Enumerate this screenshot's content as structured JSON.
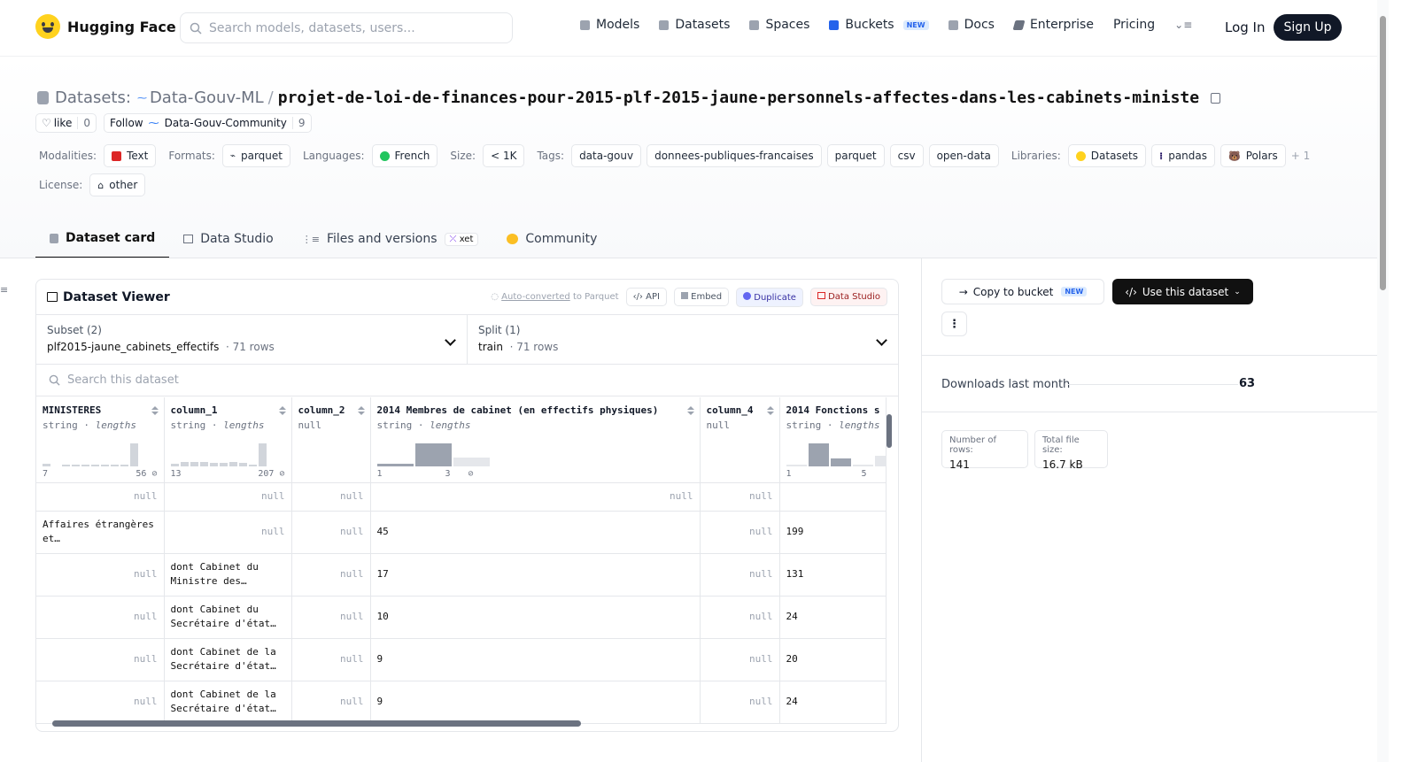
{
  "nav": {
    "brand": "Hugging Face",
    "search_placeholder": "Search models, datasets, users...",
    "links": [
      {
        "label": "Models",
        "color": "#9ca3af"
      },
      {
        "label": "Datasets",
        "color": "#9ca3af"
      },
      {
        "label": "Spaces",
        "color": "#9ca3af"
      },
      {
        "label": "Buckets",
        "color": "#2563eb"
      },
      {
        "label": "Docs",
        "color": "#9ca3af"
      },
      {
        "label": "Enterprise",
        "color": "#6b7280"
      },
      {
        "label": "Pricing"
      }
    ],
    "new_badge": "NEW",
    "login": "Log In",
    "signup": "Sign Up"
  },
  "header": {
    "prefix": "Datasets:",
    "owner": "Data-Gouv-ML",
    "slash": "/",
    "repo": "projet-de-loi-de-finances-pour-2015-plf-2015-jaune-personnels-affectes-dans-les-cabinets-ministe",
    "like_label": "like",
    "like_count": "0",
    "follow_label": "Follow",
    "follow_org": "Data-Gouv-Community",
    "follow_count": "9"
  },
  "tags": {
    "modalities_label": "Modalities:",
    "modality": "Text",
    "formats_label": "Formats:",
    "format": "parquet",
    "languages_label": "Languages:",
    "language": "French",
    "size_label": "Size:",
    "size": "< 1K",
    "tags_label": "Tags:",
    "tag_items": [
      "data-gouv",
      "donnees-publiques-francaises",
      "parquet",
      "csv",
      "open-data"
    ],
    "libraries_label": "Libraries:",
    "libraries": [
      "Datasets",
      "pandas",
      "Polars"
    ],
    "libraries_more": "+ 1",
    "license_label": "License:",
    "license": "other"
  },
  "tabs": {
    "dataset_card": "Dataset card",
    "data_studio": "Data Studio",
    "files": "Files and versions",
    "xet": "xet",
    "community": "Community"
  },
  "viewer": {
    "title": "Dataset Viewer",
    "autoconv_a": "Auto-converted",
    "autoconv_b": "to Parquet",
    "api": "API",
    "embed": "Embed",
    "duplicate": "Duplicate",
    "data_studio": "Data Studio",
    "subset_label": "Subset (2)",
    "subset_value": "plf2015-jaune_cabinets_effectifs",
    "subset_rows": "· 71 rows",
    "split_label": "Split (1)",
    "split_value": "train",
    "split_rows": "· 71 rows",
    "search_placeholder": "Search this dataset",
    "columns": [
      {
        "name": "MINISTERES",
        "type": "string",
        "stat": "lengths",
        "min": "7",
        "max": "56 ⊘"
      },
      {
        "name": "column_1",
        "type": "string",
        "stat": "lengths",
        "min": "13",
        "max": "207 ⊘"
      },
      {
        "name": "column_2",
        "type": "null"
      },
      {
        "name": "2014 Membres de cabinet (en effectifs physiques)",
        "type": "string",
        "stat": "lengths",
        "min": "1",
        "mid": "3",
        "max": "⊘"
      },
      {
        "name": "column_4",
        "type": "null"
      },
      {
        "name": "2014 Fonctions s",
        "type": "string",
        "stat": "lengths",
        "min": "1",
        "max": "5"
      }
    ],
    "rows": [
      [
        "null",
        "null",
        "null",
        "null",
        "null",
        ""
      ],
      [
        "Affaires étrangères et…",
        "null",
        "null",
        "45",
        "null",
        "199"
      ],
      [
        "null",
        "dont Cabinet du Ministre des…",
        "null",
        "17",
        "null",
        "131"
      ],
      [
        "null",
        "dont Cabinet du Secrétaire d'état…",
        "null",
        "10",
        "null",
        "24"
      ],
      [
        "null",
        "dont Cabinet de la Secrétaire d'état…",
        "null",
        "9",
        "null",
        "20"
      ],
      [
        "null",
        "dont Cabinet de la Secrétaire d'état…",
        "null",
        "9",
        "null",
        "24"
      ]
    ]
  },
  "sidebar": {
    "copy_to_bucket": "Copy to bucket",
    "new_badge": "NEW",
    "use_dataset": "Use this dataset",
    "downloads_label": "Downloads last month",
    "downloads_value": "63",
    "rows_label": "Number of rows:",
    "rows_value": "141",
    "size_label": "Total file size:",
    "size_value": "16.7 kB"
  }
}
